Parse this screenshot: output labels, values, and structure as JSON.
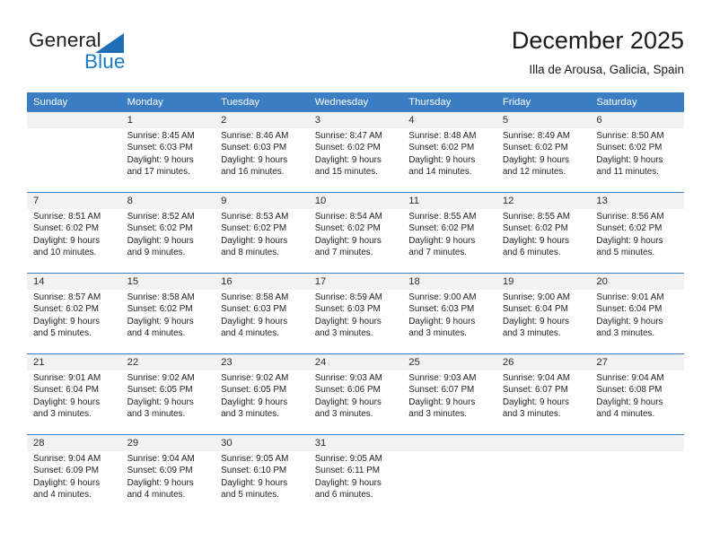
{
  "brand": {
    "name_part1": "General",
    "name_part2": "Blue",
    "triangle_color": "#1f6eb5",
    "blue_text_color": "#1a7ac4"
  },
  "header": {
    "title": "December 2025",
    "subtitle": "Illa de Arousa, Galicia, Spain"
  },
  "theme": {
    "header_bg": "#3a7dc2",
    "daynum_bg": "#f2f2f2",
    "cell_bg": "#ffffff",
    "text": "#222222"
  },
  "calendar": {
    "weekday_headers": [
      "Sunday",
      "Monday",
      "Tuesday",
      "Wednesday",
      "Thursday",
      "Friday",
      "Saturday"
    ],
    "weeks": [
      {
        "days": [
          {
            "num": "",
            "sunrise": "",
            "sunset": "",
            "daylight1": "",
            "daylight2": ""
          },
          {
            "num": "1",
            "sunrise": "Sunrise: 8:45 AM",
            "sunset": "Sunset: 6:03 PM",
            "daylight1": "Daylight: 9 hours",
            "daylight2": "and 17 minutes."
          },
          {
            "num": "2",
            "sunrise": "Sunrise: 8:46 AM",
            "sunset": "Sunset: 6:03 PM",
            "daylight1": "Daylight: 9 hours",
            "daylight2": "and 16 minutes."
          },
          {
            "num": "3",
            "sunrise": "Sunrise: 8:47 AM",
            "sunset": "Sunset: 6:02 PM",
            "daylight1": "Daylight: 9 hours",
            "daylight2": "and 15 minutes."
          },
          {
            "num": "4",
            "sunrise": "Sunrise: 8:48 AM",
            "sunset": "Sunset: 6:02 PM",
            "daylight1": "Daylight: 9 hours",
            "daylight2": "and 14 minutes."
          },
          {
            "num": "5",
            "sunrise": "Sunrise: 8:49 AM",
            "sunset": "Sunset: 6:02 PM",
            "daylight1": "Daylight: 9 hours",
            "daylight2": "and 12 minutes."
          },
          {
            "num": "6",
            "sunrise": "Sunrise: 8:50 AM",
            "sunset": "Sunset: 6:02 PM",
            "daylight1": "Daylight: 9 hours",
            "daylight2": "and 11 minutes."
          }
        ]
      },
      {
        "days": [
          {
            "num": "7",
            "sunrise": "Sunrise: 8:51 AM",
            "sunset": "Sunset: 6:02 PM",
            "daylight1": "Daylight: 9 hours",
            "daylight2": "and 10 minutes."
          },
          {
            "num": "8",
            "sunrise": "Sunrise: 8:52 AM",
            "sunset": "Sunset: 6:02 PM",
            "daylight1": "Daylight: 9 hours",
            "daylight2": "and 9 minutes."
          },
          {
            "num": "9",
            "sunrise": "Sunrise: 8:53 AM",
            "sunset": "Sunset: 6:02 PM",
            "daylight1": "Daylight: 9 hours",
            "daylight2": "and 8 minutes."
          },
          {
            "num": "10",
            "sunrise": "Sunrise: 8:54 AM",
            "sunset": "Sunset: 6:02 PM",
            "daylight1": "Daylight: 9 hours",
            "daylight2": "and 7 minutes."
          },
          {
            "num": "11",
            "sunrise": "Sunrise: 8:55 AM",
            "sunset": "Sunset: 6:02 PM",
            "daylight1": "Daylight: 9 hours",
            "daylight2": "and 7 minutes."
          },
          {
            "num": "12",
            "sunrise": "Sunrise: 8:55 AM",
            "sunset": "Sunset: 6:02 PM",
            "daylight1": "Daylight: 9 hours",
            "daylight2": "and 6 minutes."
          },
          {
            "num": "13",
            "sunrise": "Sunrise: 8:56 AM",
            "sunset": "Sunset: 6:02 PM",
            "daylight1": "Daylight: 9 hours",
            "daylight2": "and 5 minutes."
          }
        ]
      },
      {
        "days": [
          {
            "num": "14",
            "sunrise": "Sunrise: 8:57 AM",
            "sunset": "Sunset: 6:02 PM",
            "daylight1": "Daylight: 9 hours",
            "daylight2": "and 5 minutes."
          },
          {
            "num": "15",
            "sunrise": "Sunrise: 8:58 AM",
            "sunset": "Sunset: 6:02 PM",
            "daylight1": "Daylight: 9 hours",
            "daylight2": "and 4 minutes."
          },
          {
            "num": "16",
            "sunrise": "Sunrise: 8:58 AM",
            "sunset": "Sunset: 6:03 PM",
            "daylight1": "Daylight: 9 hours",
            "daylight2": "and 4 minutes."
          },
          {
            "num": "17",
            "sunrise": "Sunrise: 8:59 AM",
            "sunset": "Sunset: 6:03 PM",
            "daylight1": "Daylight: 9 hours",
            "daylight2": "and 3 minutes."
          },
          {
            "num": "18",
            "sunrise": "Sunrise: 9:00 AM",
            "sunset": "Sunset: 6:03 PM",
            "daylight1": "Daylight: 9 hours",
            "daylight2": "and 3 minutes."
          },
          {
            "num": "19",
            "sunrise": "Sunrise: 9:00 AM",
            "sunset": "Sunset: 6:04 PM",
            "daylight1": "Daylight: 9 hours",
            "daylight2": "and 3 minutes."
          },
          {
            "num": "20",
            "sunrise": "Sunrise: 9:01 AM",
            "sunset": "Sunset: 6:04 PM",
            "daylight1": "Daylight: 9 hours",
            "daylight2": "and 3 minutes."
          }
        ]
      },
      {
        "days": [
          {
            "num": "21",
            "sunrise": "Sunrise: 9:01 AM",
            "sunset": "Sunset: 6:04 PM",
            "daylight1": "Daylight: 9 hours",
            "daylight2": "and 3 minutes."
          },
          {
            "num": "22",
            "sunrise": "Sunrise: 9:02 AM",
            "sunset": "Sunset: 6:05 PM",
            "daylight1": "Daylight: 9 hours",
            "daylight2": "and 3 minutes."
          },
          {
            "num": "23",
            "sunrise": "Sunrise: 9:02 AM",
            "sunset": "Sunset: 6:05 PM",
            "daylight1": "Daylight: 9 hours",
            "daylight2": "and 3 minutes."
          },
          {
            "num": "24",
            "sunrise": "Sunrise: 9:03 AM",
            "sunset": "Sunset: 6:06 PM",
            "daylight1": "Daylight: 9 hours",
            "daylight2": "and 3 minutes."
          },
          {
            "num": "25",
            "sunrise": "Sunrise: 9:03 AM",
            "sunset": "Sunset: 6:07 PM",
            "daylight1": "Daylight: 9 hours",
            "daylight2": "and 3 minutes."
          },
          {
            "num": "26",
            "sunrise": "Sunrise: 9:04 AM",
            "sunset": "Sunset: 6:07 PM",
            "daylight1": "Daylight: 9 hours",
            "daylight2": "and 3 minutes."
          },
          {
            "num": "27",
            "sunrise": "Sunrise: 9:04 AM",
            "sunset": "Sunset: 6:08 PM",
            "daylight1": "Daylight: 9 hours",
            "daylight2": "and 4 minutes."
          }
        ]
      },
      {
        "days": [
          {
            "num": "28",
            "sunrise": "Sunrise: 9:04 AM",
            "sunset": "Sunset: 6:09 PM",
            "daylight1": "Daylight: 9 hours",
            "daylight2": "and 4 minutes."
          },
          {
            "num": "29",
            "sunrise": "Sunrise: 9:04 AM",
            "sunset": "Sunset: 6:09 PM",
            "daylight1": "Daylight: 9 hours",
            "daylight2": "and 4 minutes."
          },
          {
            "num": "30",
            "sunrise": "Sunrise: 9:05 AM",
            "sunset": "Sunset: 6:10 PM",
            "daylight1": "Daylight: 9 hours",
            "daylight2": "and 5 minutes."
          },
          {
            "num": "31",
            "sunrise": "Sunrise: 9:05 AM",
            "sunset": "Sunset: 6:11 PM",
            "daylight1": "Daylight: 9 hours",
            "daylight2": "and 6 minutes."
          },
          {
            "num": "",
            "sunrise": "",
            "sunset": "",
            "daylight1": "",
            "daylight2": ""
          },
          {
            "num": "",
            "sunrise": "",
            "sunset": "",
            "daylight1": "",
            "daylight2": ""
          },
          {
            "num": "",
            "sunrise": "",
            "sunset": "",
            "daylight1": "",
            "daylight2": ""
          }
        ]
      }
    ]
  }
}
